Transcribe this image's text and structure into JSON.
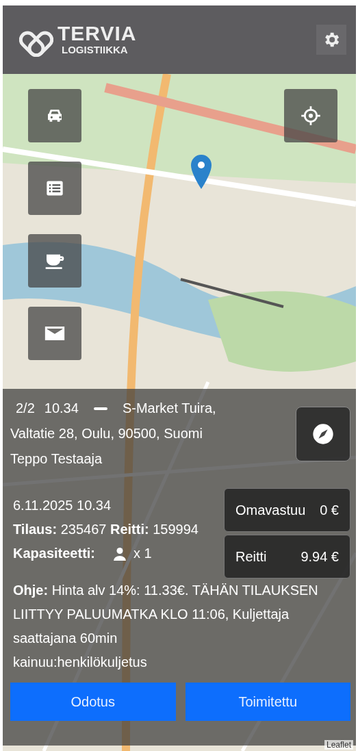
{
  "header": {
    "logo_title": "TERVIA",
    "logo_subtitle": "LOGISTIIKKA"
  },
  "map": {
    "attribution": "Leaflet"
  },
  "stop": {
    "index": "2/2",
    "time": "10.34",
    "name": "S-Market Tuira,",
    "address": "Valtatie 28, Oulu, 90500, Suomi",
    "customer": "Teppo Testaaja"
  },
  "details": {
    "datetime": "6.11.2025 10.34",
    "order": "**Tilaus:** 235467   **Reitti:** 159994",
    "capacity_label": "Kapasiteetti:",
    "capacity": "x 1",
    "note": "**Ohje:** Hinta alv 14%: 11.33€. TÄHÄN TILAUKSEN LIITTYY PALUUMATKA KLO 11:06, Kuljettaja saattajana 60min\nkainuu:henkilökuljetus"
  },
  "prices": [
    {
      "label": "Omavastuu",
      "value": "0 €"
    },
    {
      "label": "Reitti",
      "value": "9.94 €"
    }
  ],
  "actions": [
    {
      "label": "Odotus"
    },
    {
      "label": "Toimitettu"
    }
  ]
}
